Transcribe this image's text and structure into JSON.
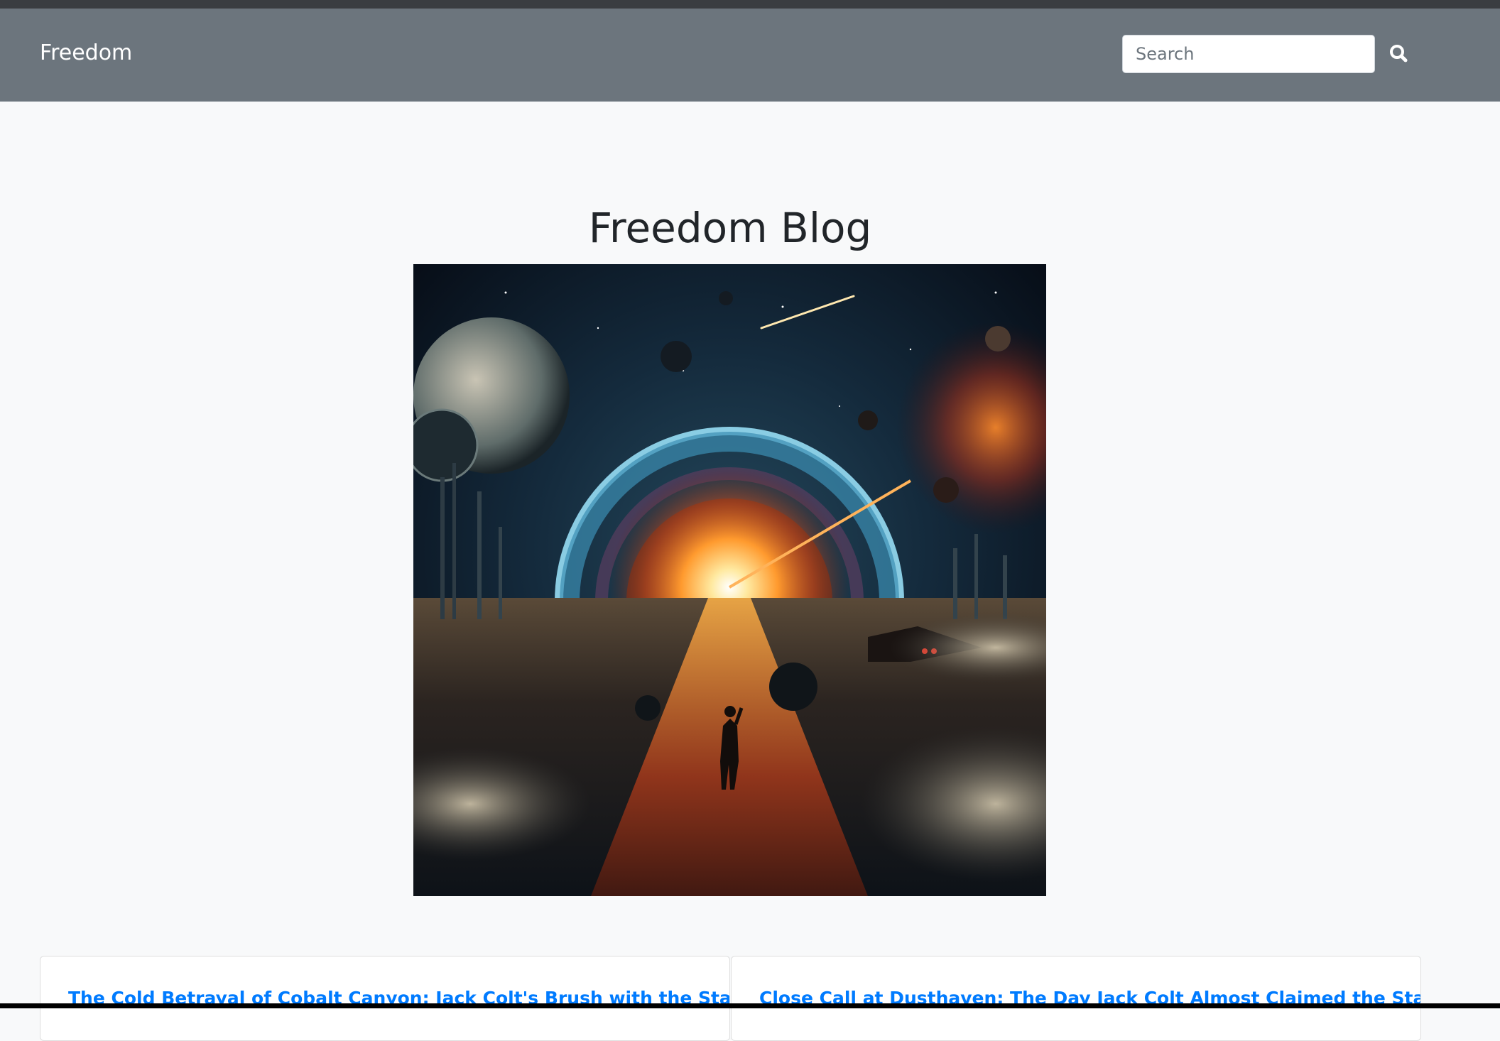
{
  "navbar": {
    "brand": "Freedom",
    "search": {
      "placeholder": "Search"
    },
    "search_button_icon": "search-icon"
  },
  "main": {
    "title": "Freedom Blog",
    "hero_image": "sci-fi-gateway-illustration"
  },
  "posts": [
    {
      "title": "The Cold Betrayal of Cobalt Canyon: Jack Colt's Brush with the Starry"
    },
    {
      "title": "Close Call at Dusthaven: The Day Jack Colt Almost Claimed the Starry"
    }
  ],
  "colors": {
    "navbar_bg": "#6c757d",
    "page_bg": "#f8f9fa",
    "link": "#007bff"
  }
}
